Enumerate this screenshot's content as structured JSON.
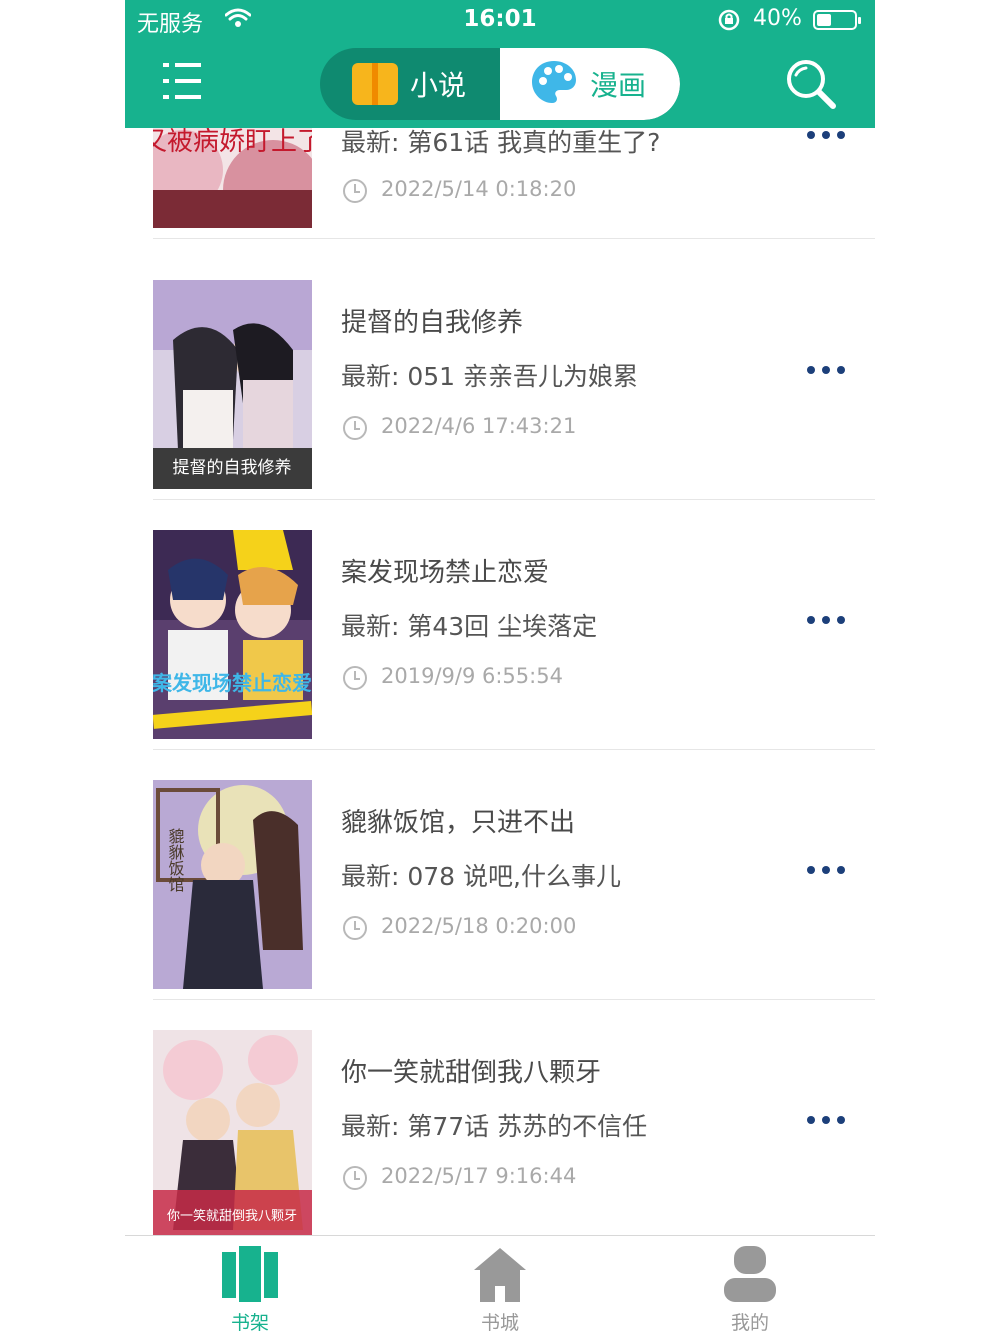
{
  "status_bar": {
    "carrier": "无服务",
    "time": "16:01",
    "battery": "40%",
    "battery_level": 0.4
  },
  "header": {
    "menu_icon": "menu-lines-icon",
    "search_icon": "search-icon",
    "tabs": [
      {
        "label": "小说",
        "icon": "book-icon",
        "active": false
      },
      {
        "label": "漫画",
        "icon": "palette-icon",
        "active": true
      }
    ],
    "accent_color": "#17b28e"
  },
  "comics": [
    {
      "title": "",
      "latest": "最新: 第61话 我真的重生了?",
      "time": "2022/5/14 0:18:20",
      "cover_text": "又被病娇盯上了"
    },
    {
      "title": "提督的自我修养",
      "latest": "最新: 051 亲亲吾儿为娘累",
      "time": "2022/4/6 17:43:21",
      "cover_text": "提督的自我修养"
    },
    {
      "title": "案发现场禁止恋爱",
      "latest": "最新: 第43回 尘埃落定",
      "time": "2019/9/9 6:55:54",
      "cover_text": "案发现场禁止恋爱"
    },
    {
      "title": "貔貅饭馆，只进不出",
      "latest": "最新: 078 说吧,什么事儿",
      "time": "2022/5/18 0:20:00",
      "cover_text": "貔貅饭馆"
    },
    {
      "title": "你一笑就甜倒我八颗牙",
      "latest": "最新: 第77话 苏苏的不信任",
      "time": "2022/5/17 9:16:44",
      "cover_text": "你一笑就甜倒我八颗牙"
    }
  ],
  "tabbar": {
    "items": [
      {
        "label": "书架",
        "icon": "bookshelf-icon",
        "active": true
      },
      {
        "label": "书城",
        "icon": "home-icon",
        "active": false
      },
      {
        "label": "我的",
        "icon": "user-icon",
        "active": false
      }
    ],
    "active_color": "#17b28e",
    "inactive_color": "#999999"
  }
}
